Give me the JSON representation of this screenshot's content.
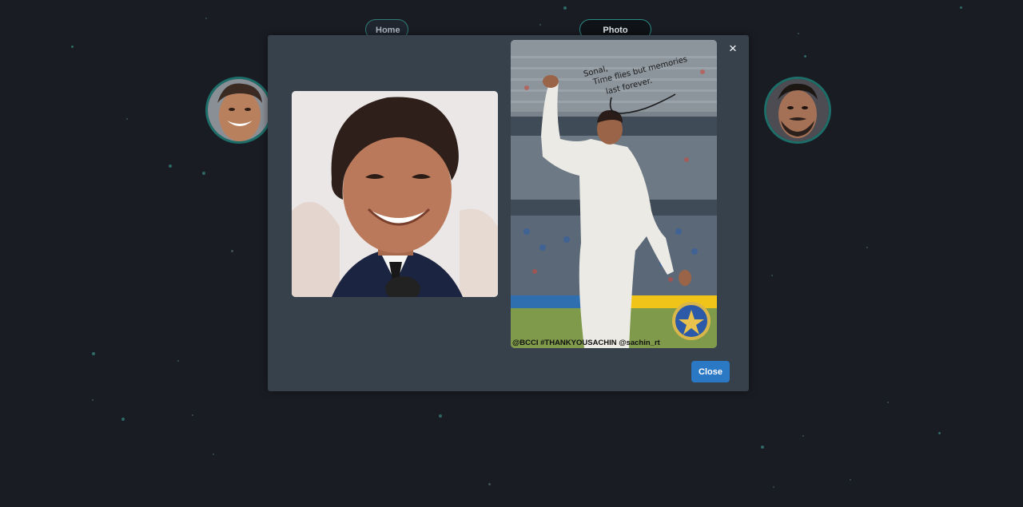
{
  "nav": {
    "home_label": "Home",
    "gallery_label": "Photo Gallary"
  },
  "modal": {
    "close_label": "Close",
    "close_icon": "×",
    "caption": "@BCCI #THANKYOUSACHIN @sachin_rt",
    "handwritten_note": [
      "Sonal,",
      "Time flies but memories",
      "last forever."
    ]
  },
  "colors": {
    "background": "#191c23",
    "modal_bg": "#36414c",
    "accent_teal": "#2b8a83",
    "primary_button": "#2b78c5"
  },
  "icons": {
    "close": "close-icon"
  }
}
